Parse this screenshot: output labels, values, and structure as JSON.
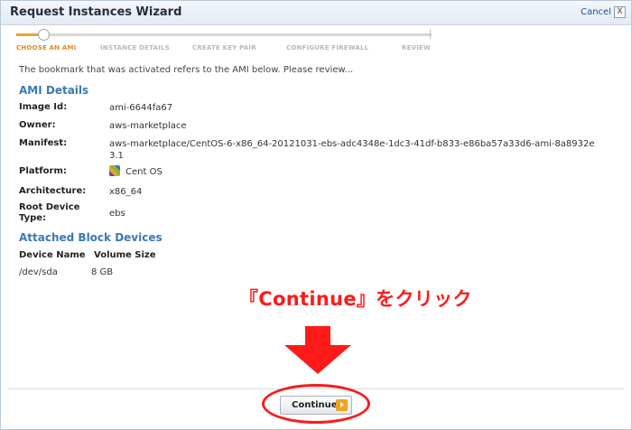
{
  "dialog": {
    "title": "Request Instances Wizard",
    "cancel_label": "Cancel",
    "close_glyph": "X"
  },
  "steps": [
    {
      "label": "CHOOSE AN AMI",
      "active": true
    },
    {
      "label": "INSTANCE DETAILS",
      "active": false
    },
    {
      "label": "CREATE KEY PAIR",
      "active": false
    },
    {
      "label": "CONFIGURE FIREWALL",
      "active": false
    },
    {
      "label": "REVIEW",
      "active": false
    }
  ],
  "intro_text": "The bookmark that was activated refers to the AMI below. Please review...",
  "ami_details": {
    "heading": "AMI Details",
    "image_id_label": "Image Id:",
    "image_id": "ami-6644fa67",
    "owner_label": "Owner:",
    "owner": "aws-marketplace",
    "manifest_label": "Manifest:",
    "manifest": "aws-marketplace/CentOS-6-x86_64-20121031-ebs-adc4348e-1dc3-41df-b833-e86ba57a33d6-ami-8a8932e3.1",
    "platform_label": "Platform:",
    "platform": "Cent OS",
    "platform_icon": "centos-icon",
    "architecture_label": "Architecture:",
    "architecture": "x86_64",
    "root_device_type_label": "Root Device Type:",
    "root_device_type": "ebs"
  },
  "block_devices": {
    "heading": "Attached Block Devices",
    "columns": [
      "Device Name",
      "Volume Size"
    ],
    "rows": [
      [
        "/dev/sda",
        "8 GB"
      ]
    ]
  },
  "annotation": {
    "text": "『Continue』をクリック",
    "color": "#ff1a1a"
  },
  "footer": {
    "continue_label": "Continue",
    "continue_icon": "arrow-right-icon"
  },
  "colors": {
    "accent_blue": "#3a78b5",
    "active_step": "#e08a1e",
    "button_icon": "#f1a21e"
  }
}
